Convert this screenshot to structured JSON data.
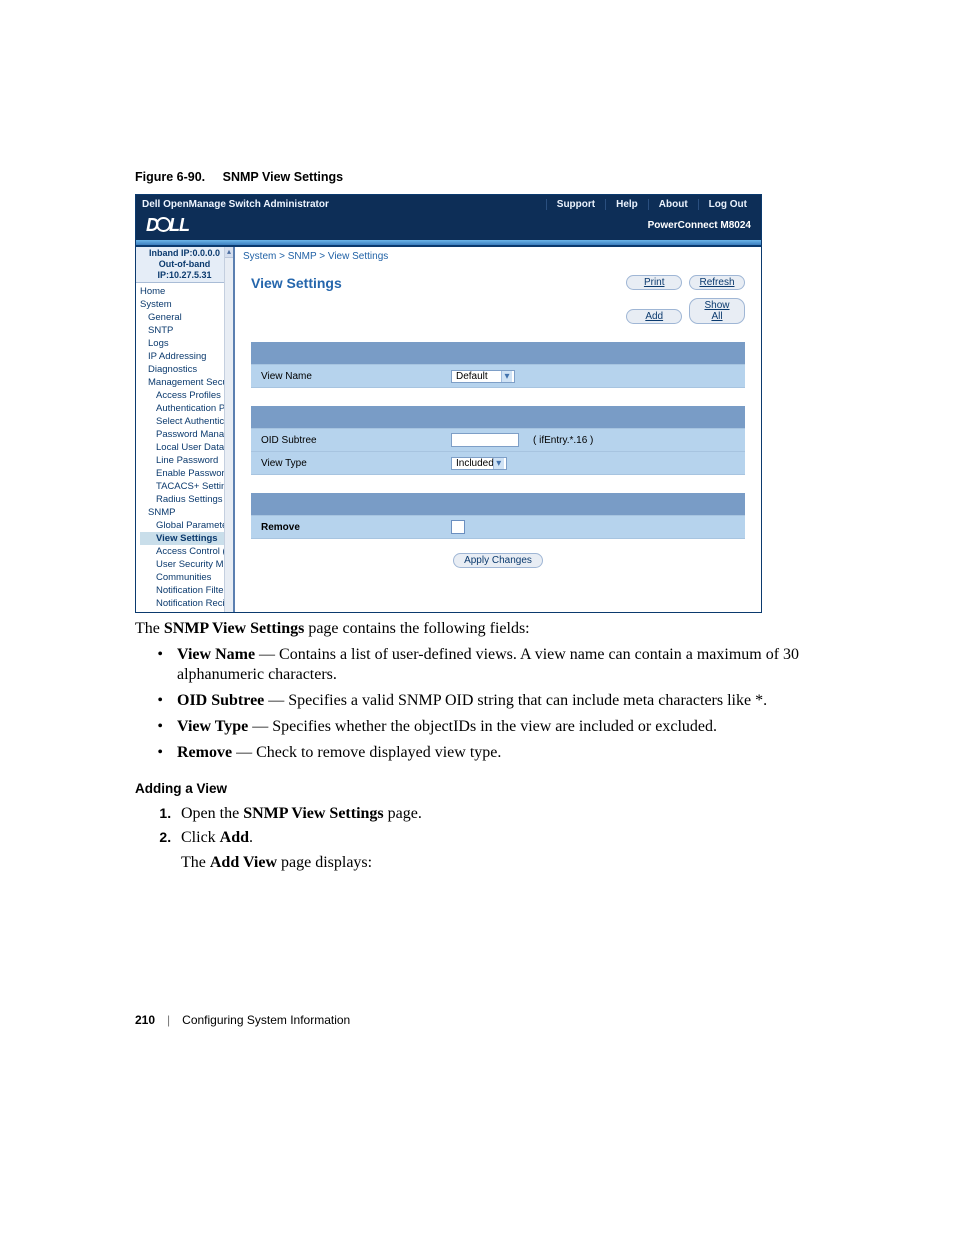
{
  "figure": {
    "label": "Figure 6-90.",
    "title": "SNMP View Settings"
  },
  "shot": {
    "topbar": {
      "title": "Dell OpenManage Switch Administrator",
      "links": [
        "Support",
        "Help",
        "About",
        "Log Out"
      ]
    },
    "logo_text": "DELL",
    "product": "PowerConnect M8024",
    "ip": {
      "inband": "Inband IP:0.0.0.0",
      "outband": "Out-of-band IP:10.27.5.31"
    },
    "tree": [
      "Home",
      "System",
      " General",
      " SNTP",
      " Logs",
      " IP Addressing",
      " Diagnostics",
      " Management Secur",
      "  Access Profiles",
      "  Authentication P",
      "  Select Authentic",
      "  Password Manag",
      "  Local User Datab",
      "  Line Password",
      "  Enable Passwor",
      "  TACACS+ Settin",
      "  Radius Settings",
      " SNMP",
      "  Global Paramete",
      "  View Settings",
      "  Access Control (",
      "  User Security Mo",
      "  Communities",
      "  Notification Filter",
      "  Notification Recip"
    ],
    "tree_selected_index": 19,
    "breadcrumbs": "System > SNMP > View Settings",
    "panel_title": "View Settings",
    "buttons": {
      "print": "Print",
      "refresh": "Refresh",
      "add": "Add",
      "showall": "Show All",
      "apply": "Apply Changes"
    },
    "form": {
      "view_name_label": "View Name",
      "view_name_value": "Default",
      "oid_label": "OID Subtree",
      "oid_hint": "( ifEntry.*.16 )",
      "view_type_label": "View Type",
      "view_type_value": "Included",
      "remove_label": "Remove"
    }
  },
  "intro": {
    "pre": "The ",
    "bold": "SNMP View Settings",
    "post": " page contains the following fields:"
  },
  "fields": [
    {
      "term": "View Name",
      "dash": " — ",
      "desc": "Contains a list of user-defined views. A view name can contain a maximum of 30 alphanumeric characters."
    },
    {
      "term": "OID Subtree",
      "dash": " — ",
      "desc": "Specifies a valid SNMP OID string that can include meta characters like *."
    },
    {
      "term": "View Type",
      "dash": " — ",
      "desc": "Specifies whether the objectIDs in the view are included or excluded."
    },
    {
      "term": "Remove",
      "dash": " — ",
      "desc": "Check to remove displayed view type."
    }
  ],
  "section_heading": "Adding a View",
  "steps": [
    {
      "pre": "Open the ",
      "bold": "SNMP View Settings",
      "post": " page."
    },
    {
      "pre": "Click ",
      "bold": "Add",
      "post": ".",
      "para_pre": "The ",
      "para_bold": "Add View",
      "para_post": " page displays:"
    }
  ],
  "footer": {
    "page": "210",
    "section": "Configuring System Information"
  }
}
